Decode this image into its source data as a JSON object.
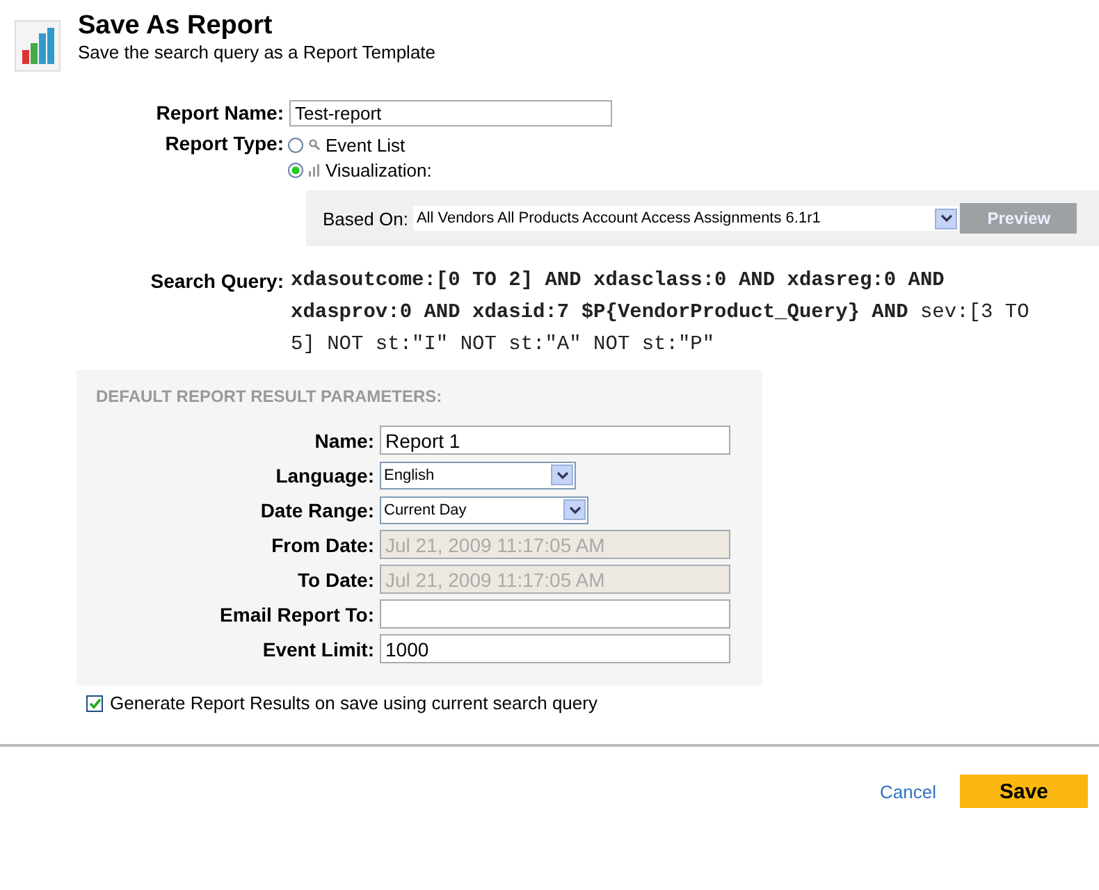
{
  "header": {
    "title": "Save As Report",
    "subtitle": "Save the search query as a Report Template"
  },
  "report_name": {
    "label": "Report Name:",
    "value": "Test-report"
  },
  "report_type": {
    "label": "Report Type:",
    "options": [
      {
        "label": "Event List",
        "kind": "search",
        "selected": false
      },
      {
        "label": "Visualization:",
        "kind": "chart",
        "selected": true
      }
    ]
  },
  "based_on": {
    "label": "Based On:",
    "value": "All Vendors All Products Account Access Assignments 6.1r1",
    "button": "Preview"
  },
  "search_query": {
    "label": "Search Query:",
    "text": "**xdasoutcome:[0 TO 2] AND xdasclass:0 AND xdasreg:0 AND xdasprov:0 AND xdasid:7 $P{VendorProduct_Query} AND** sev:[3 TO 5] NOT st:\"I\" NOT st:\"A\" NOT st:\"P\""
  },
  "params": {
    "title": "DEFAULT REPORT RESULT PARAMETERS:",
    "fields": [
      {
        "label": "Name:",
        "kind": "text",
        "value": "Report 1"
      },
      {
        "label": "Language:",
        "kind": "select",
        "value": "English"
      },
      {
        "label": "Date Range:",
        "kind": "select",
        "value": "Current Day"
      },
      {
        "label": "From Date:",
        "kind": "disabled",
        "value": "Jul 21, 2009 11:17:05 AM"
      },
      {
        "label": "To Date:",
        "kind": "disabled",
        "value": "Jul 21, 2009 11:17:05 AM"
      },
      {
        "label": "Email Report To:",
        "kind": "text"
      },
      {
        "label": "Event Limit:",
        "kind": "text",
        "value": "1000"
      }
    ]
  },
  "generate": {
    "label": "Generate Report Results on save using current search query",
    "checked": true
  },
  "footer": {
    "cancel": "Cancel",
    "save": "Save"
  }
}
